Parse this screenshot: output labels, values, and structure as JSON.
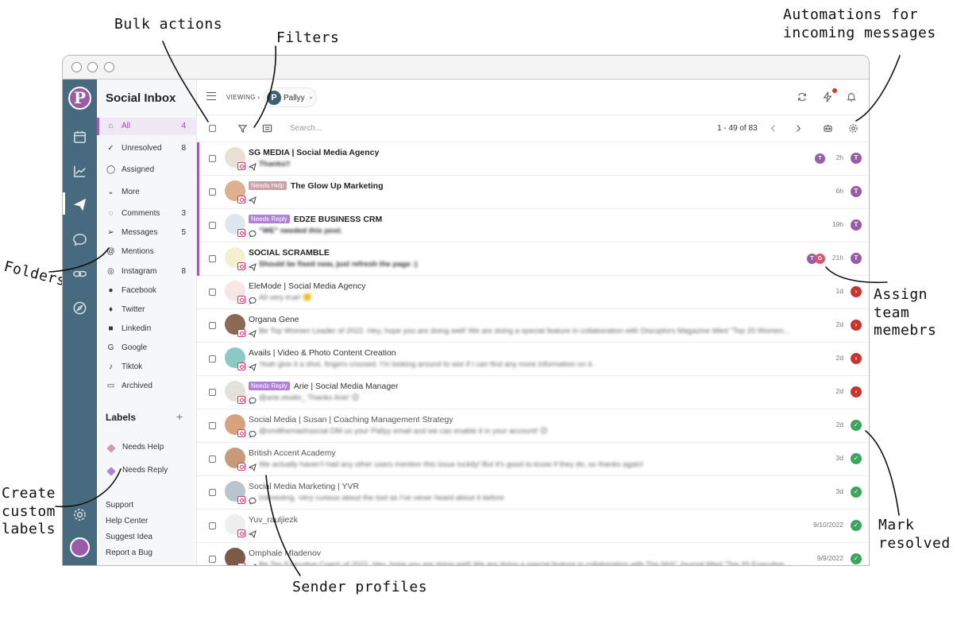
{
  "annotations": {
    "bulk_actions": "Bulk actions",
    "filters": "Filters",
    "automations": "Automations for\nincoming messages",
    "folders": "Folders",
    "assign": "Assign\nteam\nmemebrs",
    "custom_labels": "Create\ncustom\nlabels",
    "sender_profiles": "Sender profiles",
    "mark_resolved": "Mark\nresolved"
  },
  "app": {
    "title": "Social Inbox",
    "logo_letter": "P"
  },
  "sidebar": {
    "items": [
      {
        "label": "All",
        "count": "4",
        "icon": "inbox-icon"
      },
      {
        "label": "Unresolved",
        "count": "8",
        "icon": "check-icon"
      },
      {
        "label": "Assigned",
        "count": "",
        "icon": "user-icon"
      },
      {
        "label": "More",
        "count": "",
        "icon": "chevron-down-icon"
      },
      {
        "label": "Comments",
        "count": "3",
        "icon": "comment-icon"
      },
      {
        "label": "Messages",
        "count": "5",
        "icon": "send-icon"
      },
      {
        "label": "Mentions",
        "count": "",
        "icon": "at-icon"
      },
      {
        "label": "Instagram",
        "count": "8",
        "icon": "instagram-icon"
      },
      {
        "label": "Facebook",
        "count": "",
        "icon": "facebook-icon"
      },
      {
        "label": "Twitter",
        "count": "",
        "icon": "twitter-icon"
      },
      {
        "label": "Linkedin",
        "count": "",
        "icon": "linkedin-icon"
      },
      {
        "label": "Google",
        "count": "",
        "icon": "google-icon"
      },
      {
        "label": "Tiktok",
        "count": "",
        "icon": "tiktok-icon"
      },
      {
        "label": "Archived",
        "count": "",
        "icon": "archive-icon"
      }
    ],
    "labels_heading": "Labels",
    "add_label": "+",
    "labels": [
      {
        "label": "Needs Help",
        "color": "#c9a0a7"
      },
      {
        "label": "Needs Reply",
        "color": "#b07fd8"
      }
    ],
    "footer": [
      "Support",
      "Help Center",
      "Suggest Idea",
      "Report a Bug"
    ]
  },
  "topbar": {
    "viewing": "VIEWING",
    "account": "Pallyy",
    "account_initial": "P"
  },
  "toolbar": {
    "search_placeholder": "Search...",
    "pager": "1 - 49 of 83"
  },
  "colors": {
    "rail": "#476a7e",
    "accent": "#a35bb8",
    "resolved": "#3aa65f",
    "unresolved": "#c7352f",
    "assigned": "#9a5ba7"
  },
  "rows": [
    {
      "name": "SG MEDIA | Social Media Agency",
      "badge": "",
      "preview": "Thanks!!",
      "channel": "send-icon",
      "time": "2h",
      "status": "assigned",
      "status_label": "T",
      "assignees": [
        "T"
      ],
      "weight": "bold",
      "unread": true,
      "avatar": "#e9e1d6"
    },
    {
      "name": "The Glow Up Marketing",
      "badge": "Needs Help",
      "preview": "",
      "channel": "send-icon",
      "time": "6h",
      "status": "assigned",
      "status_label": "T",
      "assignees": [],
      "weight": "bold",
      "unread": true,
      "avatar": "#deb08d"
    },
    {
      "name": "EDZE BUSINESS CRM",
      "badge": "Needs Reply",
      "preview": "\"WE\" needed this post.",
      "channel": "comment-icon",
      "time": "19h",
      "status": "assigned",
      "status_label": "T",
      "assignees": [],
      "weight": "bold",
      "unread": true,
      "avatar": "#dfe6ee"
    },
    {
      "name": "SOCIAL SCRAMBLE",
      "badge": "",
      "preview": "Should be fixed now, just refresh the page :)",
      "channel": "send-icon",
      "time": "21h",
      "status": "assigned",
      "status_label": "T",
      "assignees": [
        "T",
        "G"
      ],
      "weight": "bold",
      "unread": true,
      "avatar": "#f3f0d2"
    },
    {
      "name": "EleMode | Social Media Agency",
      "badge": "",
      "preview": "All very true! 🙂",
      "channel": "comment-icon",
      "time": "1d",
      "status": "unresolved",
      "status_label": "›",
      "assignees": [],
      "weight": "reg",
      "unread": false,
      "avatar": "#f6e6e6"
    },
    {
      "name": "Organa Gene",
      "badge": "",
      "preview": "Be Top Women Leader of 2022. Hey, hope you are doing well! We are doing a special feature in collaboration with Disruptors Magazine titled \"Top 20 Women...",
      "channel": "send-icon",
      "time": "2d",
      "status": "unresolved",
      "status_label": "›",
      "assignees": [],
      "weight": "reg",
      "unread": false,
      "avatar": "#8a6a55"
    },
    {
      "name": "Avails | Video & Photo Content Creation",
      "badge": "",
      "preview": "Yeah give it a shot, fingers crossed. I'm looking around to see if I can find any more information on it.",
      "channel": "send-icon",
      "time": "2d",
      "status": "unresolved",
      "status_label": "›",
      "assignees": [],
      "weight": "reg",
      "unread": false,
      "avatar": "#8cc9c5"
    },
    {
      "name": "Arie | Social Media Manager",
      "badge": "Needs Reply",
      "preview": "@arie.studio_ Thanks Arie! 😊",
      "channel": "comment-icon",
      "time": "2d",
      "status": "unresolved",
      "status_label": "›",
      "assignees": [],
      "weight": "reg",
      "unread": false,
      "avatar": "#e4e1dc"
    },
    {
      "name": "Social Media | Susan | Coaching Management Strategy",
      "badge": "",
      "preview": "@smilthemashsocial DM us your Pallyy email and we can enable it in your account! 😊",
      "channel": "comment-icon",
      "time": "2d",
      "status": "resolved",
      "status_label": "✓",
      "assignees": [],
      "weight": "light",
      "unread": false,
      "avatar": "#d8a27d"
    },
    {
      "name": "British Accent Academy",
      "badge": "",
      "preview": "We actually haven't had any other users mention this issue luckily! But it's good to know if they do, so thanks again!",
      "channel": "send-icon",
      "time": "3d",
      "status": "resolved",
      "status_label": "✓",
      "assignees": [],
      "weight": "light",
      "unread": false,
      "avatar": "#c79a7c"
    },
    {
      "name": "Social Media Marketing | YVR",
      "badge": "",
      "preview": "Interesting. Very curious about the tool as I've never heard about it before",
      "channel": "comment-icon",
      "time": "3d",
      "status": "resolved",
      "status_label": "✓",
      "assignees": [],
      "weight": "light",
      "unread": false,
      "avatar": "#b9c4cc"
    },
    {
      "name": "Yuv_rauljiezk",
      "badge": "",
      "preview": "",
      "channel": "send-icon",
      "time": "9/10/2022",
      "status": "resolved",
      "status_label": "✓",
      "assignees": [],
      "weight": "light",
      "unread": false,
      "avatar": "#eeeeee"
    },
    {
      "name": "Omphale Mladenov",
      "badge": "",
      "preview": "Be Top Executive Coach of 2022. Hey, hope you are doing well! We are doing a special feature in collaboration with The NHC Journal titled \"Top 20 Executive...",
      "channel": "send-icon",
      "time": "9/9/2022",
      "status": "resolved",
      "status_label": "✓",
      "assignees": [],
      "weight": "light",
      "unread": false,
      "avatar": "#7a5a48"
    }
  ]
}
